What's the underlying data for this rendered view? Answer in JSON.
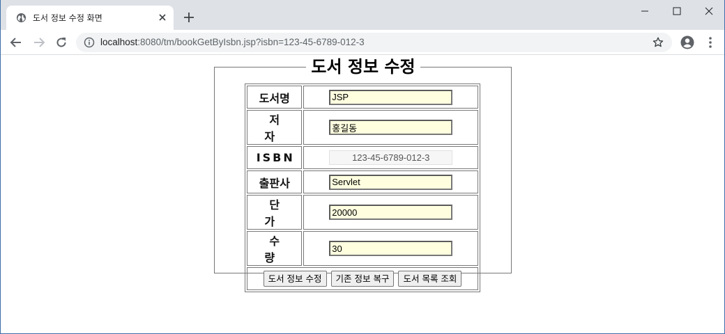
{
  "browser": {
    "tab_title": "도서 정보 수정 화면",
    "url_host": "localhost",
    "url_rest": ":8080/tm/bookGetByIsbn.jsp?isbn=123-45-6789-012-3",
    "icons": [
      "globe-icon",
      "close-icon",
      "plus-icon",
      "minimize-icon",
      "maximize-icon",
      "close-window-icon",
      "back-arrow-icon",
      "forward-arrow-icon",
      "reload-icon",
      "info-icon",
      "star-icon",
      "profile-icon",
      "menu-icon"
    ]
  },
  "form": {
    "legend": "도서 정보 수정",
    "rows": [
      {
        "label": "도서명",
        "value": "JSP"
      },
      {
        "label": "저 자",
        "value": "홍길동"
      },
      {
        "label": "ISBN",
        "value": "123-45-6789-012-3",
        "readonly": true
      },
      {
        "label": "출판사",
        "value": "Servlet"
      },
      {
        "label": "단 가",
        "value": "20000"
      },
      {
        "label": "수 량",
        "value": "30"
      }
    ],
    "buttons": {
      "update": "도서 정보 수정",
      "reset": "기존 정보 복구",
      "list": "도서 목록 조회"
    },
    "colors": {
      "input_bg": "#ffffe0",
      "border": "#777777"
    }
  }
}
